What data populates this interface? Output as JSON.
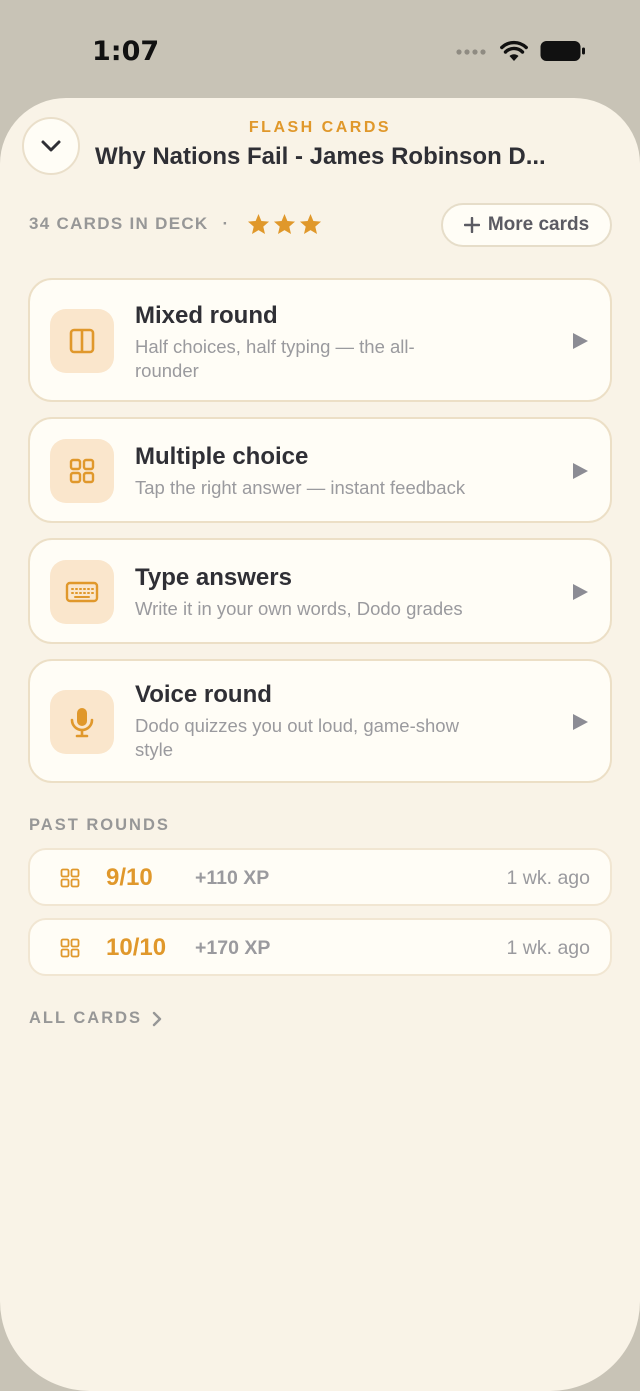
{
  "status_bar": {
    "time": "1:07"
  },
  "header": {
    "kicker": "FLASH CARDS",
    "title": "Why Nations Fail - James Robinson D..."
  },
  "deck": {
    "count_label": "34 CARDS IN DECK",
    "separator": "·",
    "stars": 3,
    "more_button_label": "More cards",
    "more_button_icon": "plus-icon"
  },
  "modes": [
    {
      "title": "Mixed round",
      "description": "Half choices, half typing — the all-rounder",
      "icon": "split-panel-icon"
    },
    {
      "title": "Multiple choice",
      "description": "Tap the right answer — instant feedback",
      "icon": "grid-icon"
    },
    {
      "title": "Type answers",
      "description": "Write it in your own words, Dodo grades",
      "icon": "keyboard-icon"
    },
    {
      "title": "Voice round",
      "description": "Dodo quizzes you out loud, game-show style",
      "icon": "microphone-icon"
    }
  ],
  "past_rounds": {
    "label": "PAST ROUNDS",
    "rounds": [
      {
        "score": "9/10",
        "xp": "+110 XP",
        "time": "1 wk. ago"
      },
      {
        "score": "10/10",
        "xp": "+170 XP",
        "time": "1 wk. ago"
      }
    ]
  },
  "all_cards_label": "ALL CARDS",
  "colors": {
    "accent": "#e0982b",
    "sheet_bg": "#f9f3e7",
    "card_bg": "#fffdf6",
    "icon_tile_bg": "#fae6cc",
    "muted_text": "#979797"
  }
}
